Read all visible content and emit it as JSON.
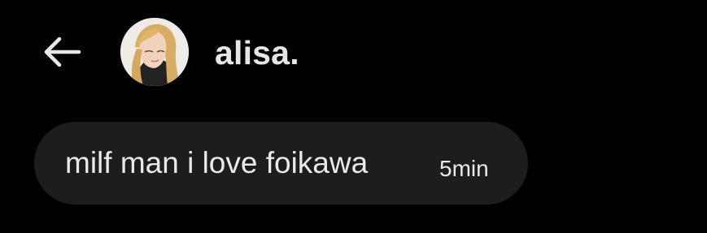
{
  "header": {
    "back_icon": "arrow-left-icon",
    "avatar_icon": "user-avatar",
    "username": "alisa."
  },
  "messages": [
    {
      "text": "milf man i love foikawa",
      "time": "5min"
    }
  ],
  "colors": {
    "background": "#000000",
    "bubble": "#1c1d1f",
    "text": "#e9e9e9"
  }
}
